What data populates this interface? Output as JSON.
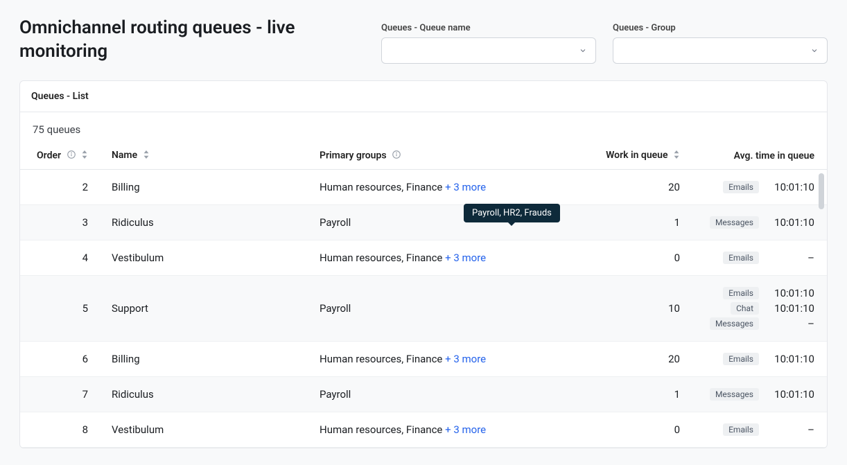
{
  "header": {
    "title": "Omnichannel routing queues - live monitoring",
    "filter_queue_label": "Queues - Queue name",
    "filter_group_label": "Queues - Group"
  },
  "card": {
    "title": "Queues - List",
    "count_text": "75 queues"
  },
  "columns": {
    "order": "Order",
    "name": "Name",
    "groups": "Primary groups",
    "work": "Work in queue",
    "avg": "Avg. time in queue"
  },
  "tooltip": "Payroll, HR2, Frauds",
  "rows": [
    {
      "order": "2",
      "name": "Billing",
      "groups_text": "Human resources, Finance ",
      "groups_more": "+ 3 more",
      "work": "20",
      "avg": [
        {
          "badge": "Emails",
          "value": "10:01:10"
        }
      ]
    },
    {
      "order": "3",
      "name": "Ridiculus",
      "groups_text": "Payroll",
      "groups_more": "",
      "work": "1",
      "avg": [
        {
          "badge": "Messages",
          "value": "10:01:10"
        }
      ]
    },
    {
      "order": "4",
      "name": "Vestibulum",
      "groups_text": "Human resources, Finance ",
      "groups_more": "+ 3 more",
      "work": "0",
      "avg": [
        {
          "badge": "Emails",
          "value": "–"
        }
      ]
    },
    {
      "order": "5",
      "name": "Support",
      "groups_text": "Payroll",
      "groups_more": "",
      "work": "10",
      "avg": [
        {
          "badge": "Emails",
          "value": "10:01:10"
        },
        {
          "badge": "Chat",
          "value": "10:01:10"
        },
        {
          "badge": "Messages",
          "value": "–"
        }
      ]
    },
    {
      "order": "6",
      "name": "Billing",
      "groups_text": "Human resources, Finance ",
      "groups_more": "+ 3 more",
      "work": "20",
      "avg": [
        {
          "badge": "Emails",
          "value": "10:01:10"
        }
      ]
    },
    {
      "order": "7",
      "name": "Ridiculus",
      "groups_text": "Payroll",
      "groups_more": "",
      "work": "1",
      "avg": [
        {
          "badge": "Messages",
          "value": "10:01:10"
        }
      ]
    },
    {
      "order": "8",
      "name": "Vestibulum",
      "groups_text": "Human resources, Finance ",
      "groups_more": "+ 3 more",
      "work": "0",
      "avg": [
        {
          "badge": "Emails",
          "value": "–"
        }
      ]
    }
  ]
}
